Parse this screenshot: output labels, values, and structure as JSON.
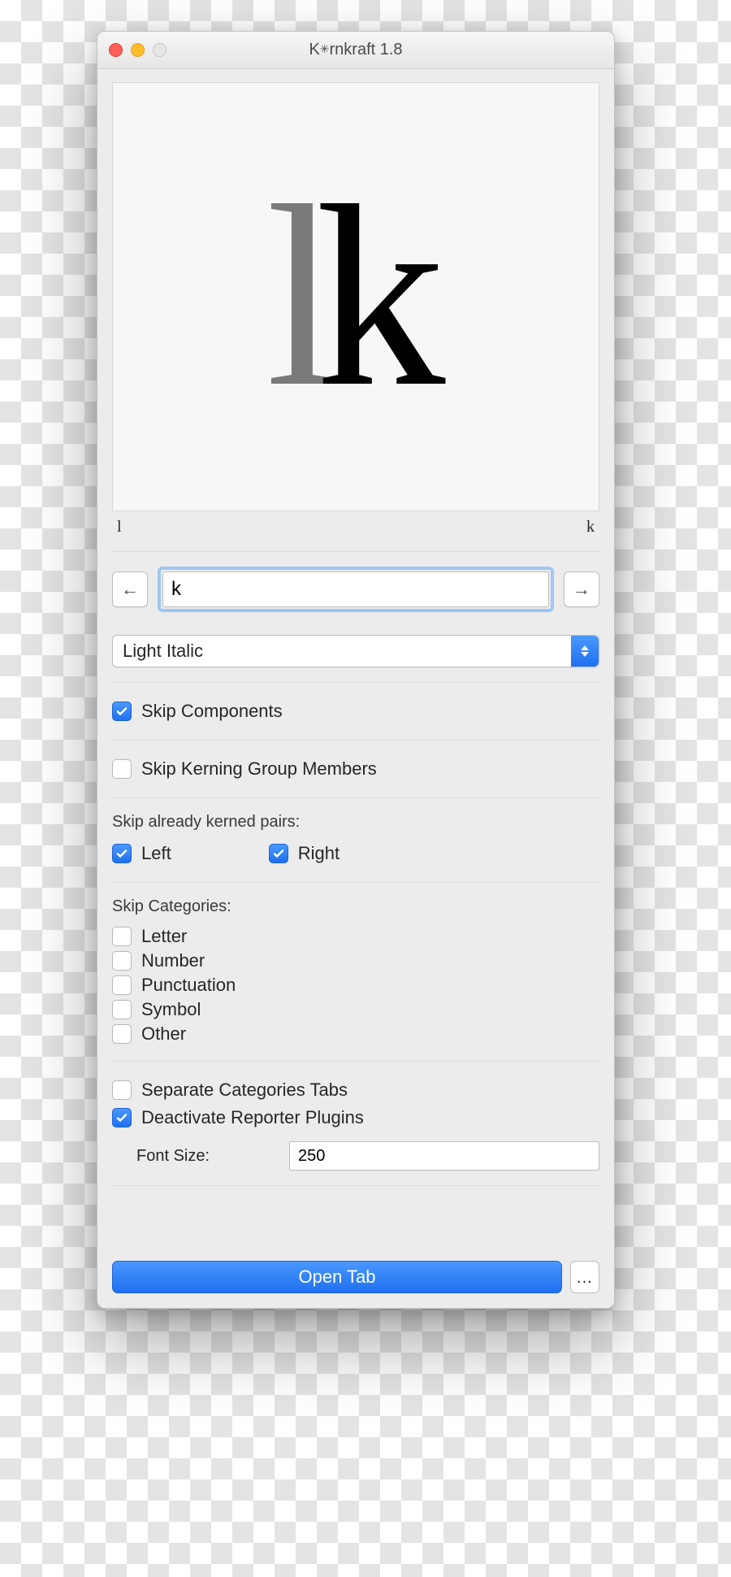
{
  "window_title": "Kernkraft 1.8",
  "preview": {
    "left_glyph": "l",
    "right_glyph": "k"
  },
  "pair_labels": {
    "left": "l",
    "right": "k"
  },
  "nav": {
    "prev": "←",
    "next": "→"
  },
  "glyph_input": {
    "value": "k"
  },
  "style_select": {
    "value": "Light Italic"
  },
  "checks": {
    "skip_components": {
      "label": "Skip Components",
      "checked": true
    },
    "skip_group_members": {
      "label": "Skip Kerning Group Members",
      "checked": false
    }
  },
  "skip_kerned": {
    "section_label": "Skip already kerned pairs:",
    "left": {
      "label": "Left",
      "checked": true
    },
    "right": {
      "label": "Right",
      "checked": true
    }
  },
  "categories": {
    "section_label": "Skip Categories:",
    "items": [
      {
        "label": "Letter",
        "checked": false
      },
      {
        "label": "Number",
        "checked": false
      },
      {
        "label": "Punctuation",
        "checked": false
      },
      {
        "label": "Symbol",
        "checked": false
      },
      {
        "label": "Other",
        "checked": false
      }
    ]
  },
  "separate_tabs": {
    "label": "Separate Categories Tabs",
    "checked": false
  },
  "deactivate_reporters": {
    "label": "Deactivate Reporter Plugins",
    "checked": true
  },
  "font_size": {
    "label": "Font Size:",
    "value": "250"
  },
  "footer": {
    "open": "Open Tab",
    "more": "..."
  }
}
